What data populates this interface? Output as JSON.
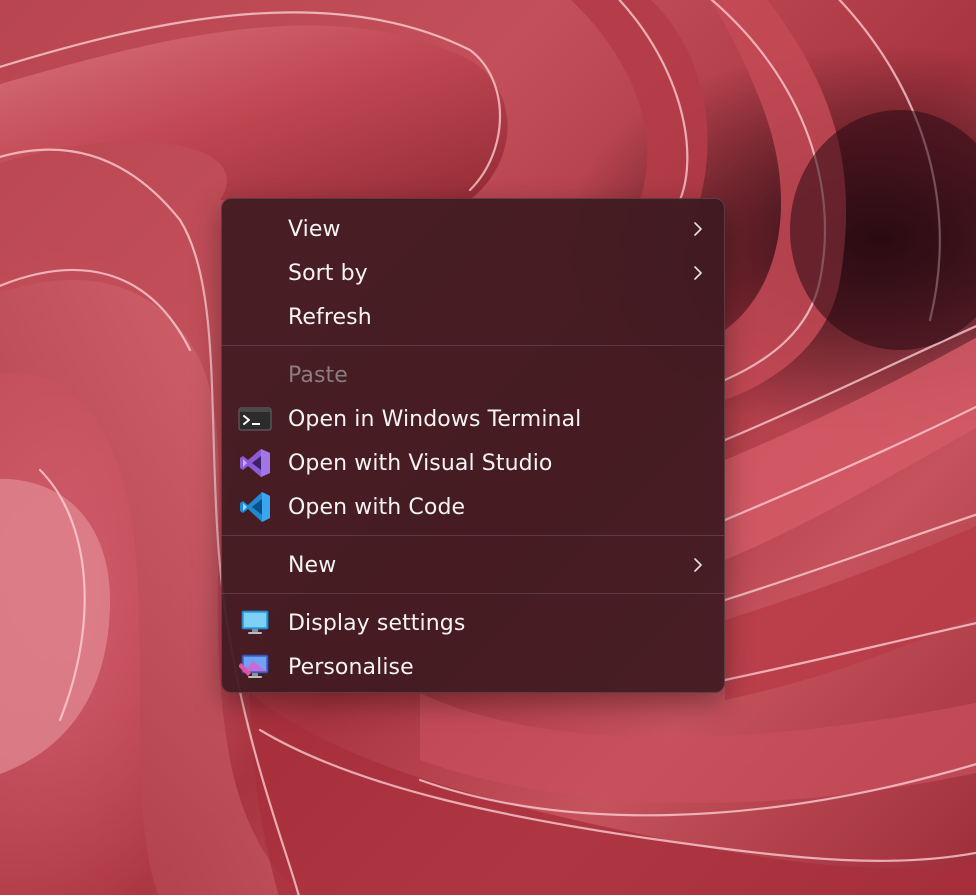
{
  "desktop": {
    "wallpaper": "red-ribbons",
    "accent_color": "#c24f5a"
  },
  "context_menu": {
    "groups": [
      {
        "items": [
          {
            "label": "View",
            "icon": null,
            "has_submenu": true,
            "enabled": true
          },
          {
            "label": "Sort by",
            "icon": null,
            "has_submenu": true,
            "enabled": true
          },
          {
            "label": "Refresh",
            "icon": null,
            "has_submenu": false,
            "enabled": true
          }
        ]
      },
      {
        "items": [
          {
            "label": "Paste",
            "icon": null,
            "has_submenu": false,
            "enabled": false
          },
          {
            "label": "Open in Windows Terminal",
            "icon": "terminal-icon",
            "has_submenu": false,
            "enabled": true
          },
          {
            "label": "Open with Visual Studio",
            "icon": "visual-studio-icon",
            "has_submenu": false,
            "enabled": true
          },
          {
            "label": "Open with Code",
            "icon": "vscode-icon",
            "has_submenu": false,
            "enabled": true
          }
        ]
      },
      {
        "items": [
          {
            "label": "New",
            "icon": null,
            "has_submenu": true,
            "enabled": true
          }
        ]
      },
      {
        "items": [
          {
            "label": "Display settings",
            "icon": "display-settings-icon",
            "has_submenu": false,
            "enabled": true
          },
          {
            "label": "Personalise",
            "icon": "personalise-icon",
            "has_submenu": false,
            "enabled": true
          }
        ]
      }
    ]
  }
}
